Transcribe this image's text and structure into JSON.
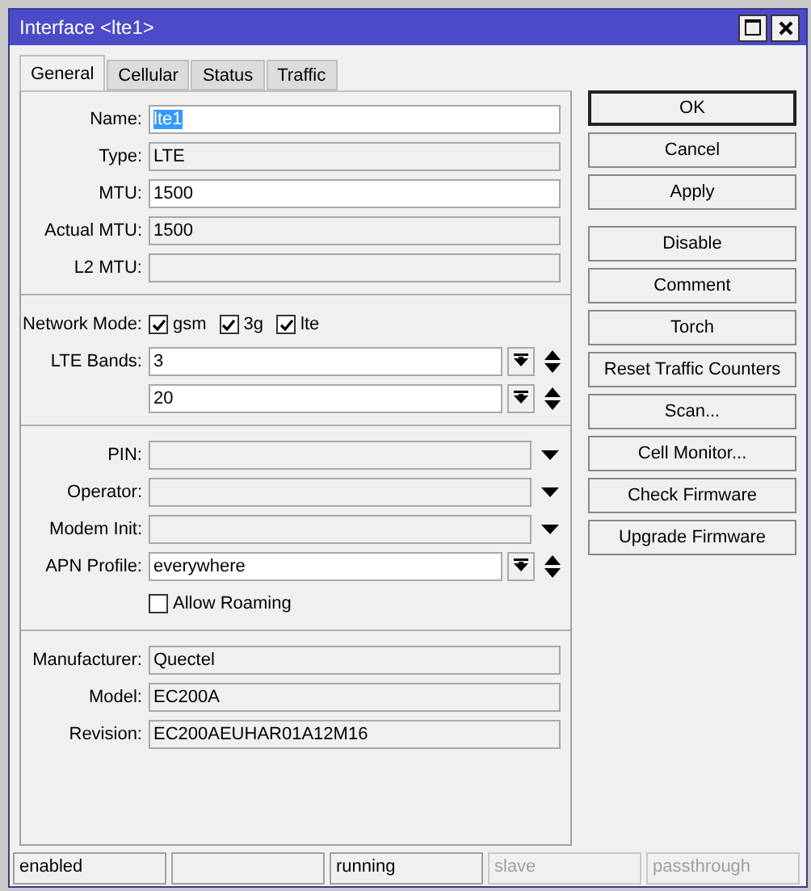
{
  "window": {
    "title": "Interface <lte1>"
  },
  "tabs": [
    {
      "label": "General",
      "selected": true
    },
    {
      "label": "Cellular",
      "selected": false
    },
    {
      "label": "Status",
      "selected": false
    },
    {
      "label": "Traffic",
      "selected": false
    }
  ],
  "sections": [
    {
      "rows": [
        {
          "kind": "input",
          "label": "Name:",
          "value": "lte1",
          "text_selected": true
        },
        {
          "kind": "readonly",
          "label": "Type:",
          "value": "LTE"
        },
        {
          "kind": "input",
          "label": "MTU:",
          "value": "1500",
          "text_selected": false
        },
        {
          "kind": "readonly",
          "label": "Actual MTU:",
          "value": "1500"
        },
        {
          "kind": "readonly",
          "label": "L2 MTU:"
        }
      ]
    },
    {
      "rows": [
        {
          "kind": "checks",
          "label": "Network Mode:",
          "options": [
            {
              "label": "gsm",
              "checked": true
            },
            {
              "label": "3g",
              "checked": true
            },
            {
              "label": "lte",
              "checked": true
            }
          ]
        },
        {
          "kind": "list",
          "label": "LTE Bands:",
          "values": [
            "3",
            "20"
          ]
        }
      ]
    },
    {
      "rows": [
        {
          "kind": "combo",
          "label": "PIN:"
        },
        {
          "kind": "combo",
          "label": "Operator:"
        },
        {
          "kind": "combo",
          "label": "Modem Init:"
        },
        {
          "kind": "list",
          "label": "APN Profile:",
          "values": [
            "everywhere"
          ]
        },
        {
          "kind": "checkbox",
          "label": "Allow Roaming",
          "checked": false
        }
      ]
    },
    {
      "rows": [
        {
          "kind": "readonly",
          "label": "Manufacturer:",
          "value": "Quectel"
        },
        {
          "kind": "readonly",
          "label": "Model:",
          "value": "EC200A"
        },
        {
          "kind": "readonly",
          "label": "Revision:",
          "value": "EC200AEUHAR01A12M16"
        }
      ]
    }
  ],
  "button_groups": [
    [
      {
        "label": "OK",
        "default": true
      },
      {
        "label": "Cancel",
        "default": false
      },
      {
        "label": "Apply",
        "default": false
      }
    ],
    [
      {
        "label": "Disable",
        "default": false
      },
      {
        "label": "Comment",
        "default": false
      },
      {
        "label": "Torch",
        "default": false
      },
      {
        "label": "Reset Traffic Counters",
        "default": false
      },
      {
        "label": "Scan...",
        "default": false
      },
      {
        "label": "Cell Monitor...",
        "default": false
      },
      {
        "label": "Check Firmware",
        "default": false
      },
      {
        "label": "Upgrade Firmware",
        "default": false
      }
    ]
  ],
  "status_bar": [
    {
      "text": "enabled",
      "disabled": false
    },
    {
      "disabled": false
    },
    {
      "text": "running",
      "disabled": false
    },
    {
      "text": "slave",
      "disabled": true
    },
    {
      "text": "passthrough",
      "disabled": true
    }
  ]
}
